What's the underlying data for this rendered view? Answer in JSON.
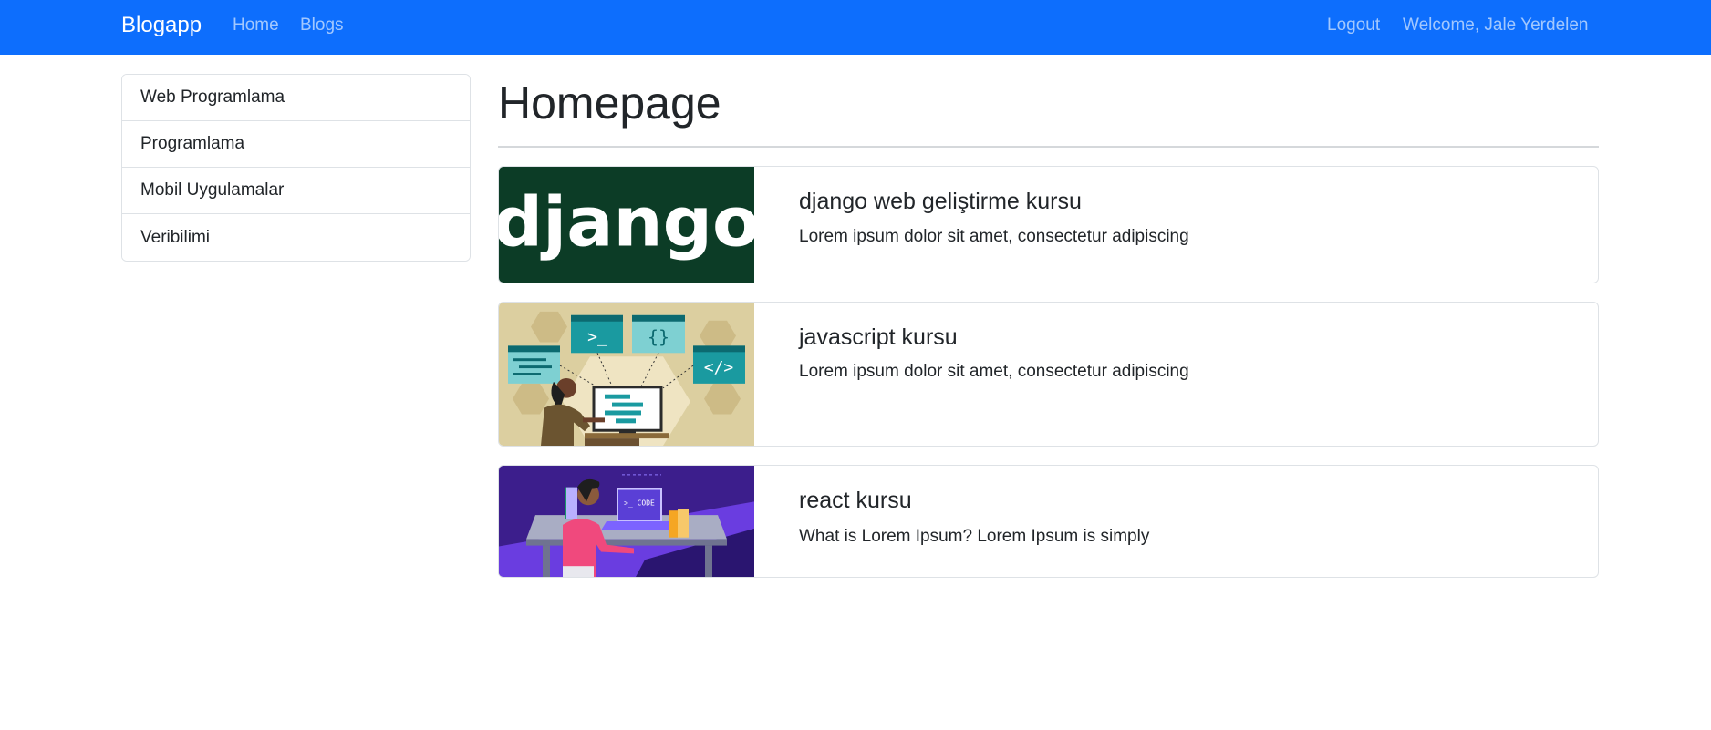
{
  "navbar": {
    "brand": "Blogapp",
    "links": {
      "home": "Home",
      "blogs": "Blogs"
    },
    "logout": "Logout",
    "welcome": "Welcome, Jale Yerdelen",
    "background": "#0d6efd"
  },
  "sidebar": {
    "categories": [
      {
        "label": "Web Programlama"
      },
      {
        "label": "Programlama"
      },
      {
        "label": "Mobil Uygulamalar"
      },
      {
        "label": "Veribilimi"
      }
    ]
  },
  "main": {
    "title": "Homepage",
    "posts": [
      {
        "title": "django web geliştirme kursu",
        "excerpt": "Lorem ipsum dolor sit amet, consectetur adipiscing",
        "thumbnail": {
          "icon": "django-logo-image",
          "logo_text": "django",
          "background": "#0c3c26"
        }
      },
      {
        "title": "javascript kursu",
        "excerpt": "Lorem ipsum dolor sit amet, consectetur adipiscing",
        "thumbnail": {
          "icon": "developer-at-computer-illustration",
          "terminal_glyph": ">_",
          "braces_glyph": "{}",
          "tag_glyph": "</>",
          "background": "#dccfa0"
        }
      },
      {
        "title": "react kursu",
        "excerpt": "What is Lorem Ipsum? Lorem Ipsum is simply",
        "thumbnail": {
          "icon": "coder-at-desk-illustration",
          "code_glyph": ">_ CODE",
          "background": "#3c1e8c"
        }
      }
    ]
  }
}
